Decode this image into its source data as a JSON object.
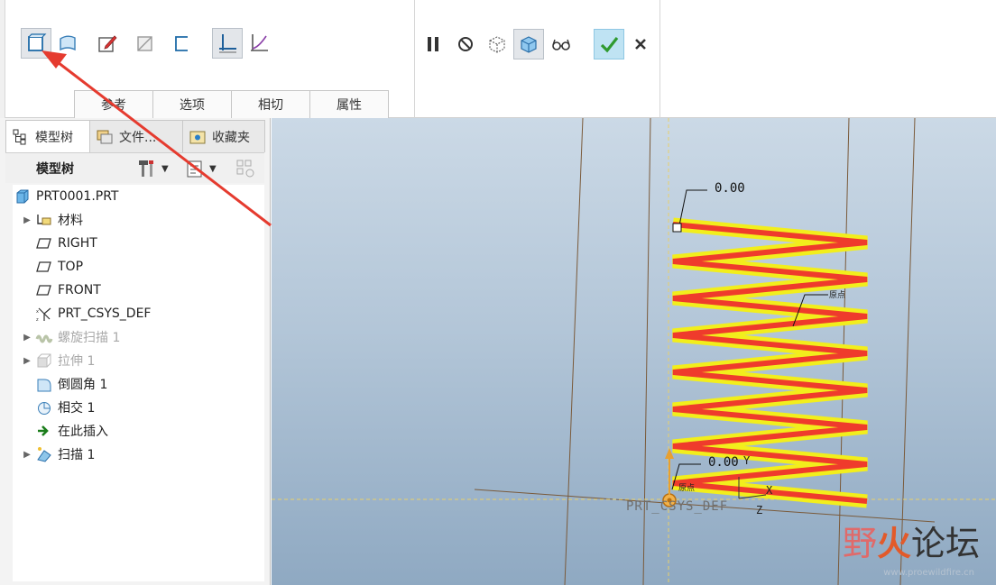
{
  "ribbon": {
    "tabs": [
      "参考",
      "选项",
      "相切",
      "属性"
    ]
  },
  "panel": {
    "tabs": [
      {
        "label": "模型树"
      },
      {
        "label": "文件..."
      },
      {
        "label": "收藏夹"
      }
    ],
    "header_title": "模型树",
    "tree": [
      {
        "label": "PRT0001.PRT"
      },
      {
        "label": "材料"
      },
      {
        "label": "RIGHT"
      },
      {
        "label": "TOP"
      },
      {
        "label": "FRONT"
      },
      {
        "label": "PRT_CSYS_DEF"
      },
      {
        "label": "螺旋扫描 1"
      },
      {
        "label": "拉伸 1"
      },
      {
        "label": "倒圆角 1"
      },
      {
        "label": "相交 1"
      },
      {
        "label": "在此插入"
      },
      {
        "label": "扫描 1"
      }
    ]
  },
  "viewport": {
    "dim_top": "0.00",
    "dim_bottom": "0.00",
    "csys_label": "PRT_CSYS_DEF",
    "axis_y": "Y",
    "axis_x": "X",
    "axis_z": "Z",
    "note_start": "原点",
    "note_bottom": "原点"
  },
  "watermark": {
    "part1": "野",
    "part2": "火",
    "part3": "论坛",
    "url": "www.proewildfire.cn"
  },
  "colors": {
    "spring_yellow": "#f2ee1c",
    "spring_red": "#ef3b2c",
    "arrow_red": "#e53b2f",
    "accent_ok": "#3aa83a"
  }
}
